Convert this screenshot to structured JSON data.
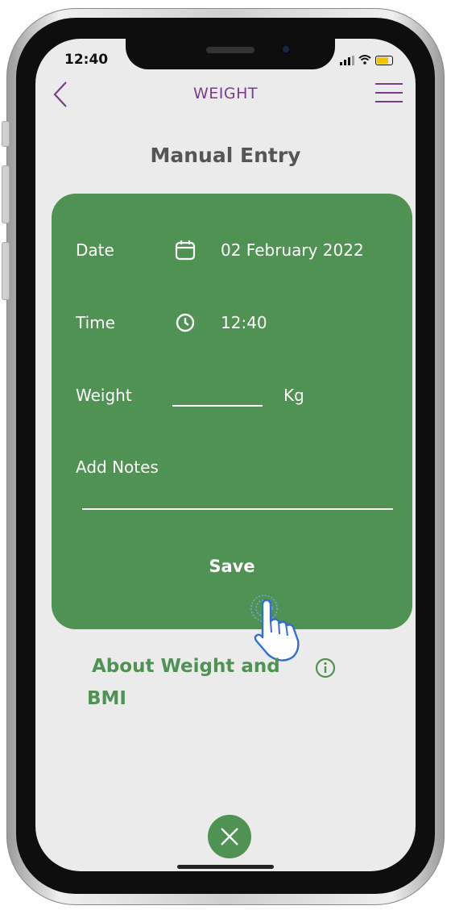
{
  "status_bar": {
    "time": "12:40"
  },
  "nav": {
    "title": "WEIGHT",
    "back_icon": "chevron-left-icon",
    "menu_icon": "hamburger-menu-icon"
  },
  "page": {
    "title": "Manual Entry"
  },
  "form": {
    "date_label": "Date",
    "date_value": "02 February 2022",
    "time_label": "Time",
    "time_value": "12:40",
    "weight_label": "Weight",
    "weight_value": "",
    "weight_unit": "Kg",
    "notes_label": "Add Notes",
    "notes_value": "",
    "save_label": "Save"
  },
  "about": {
    "line1": "About Weight and",
    "line2": "BMI"
  },
  "colors": {
    "accent_green": "#4f9254",
    "brand_purple": "#7a3c8e",
    "background": "#ebebeb",
    "tap_hand": "#2f6fd6"
  }
}
